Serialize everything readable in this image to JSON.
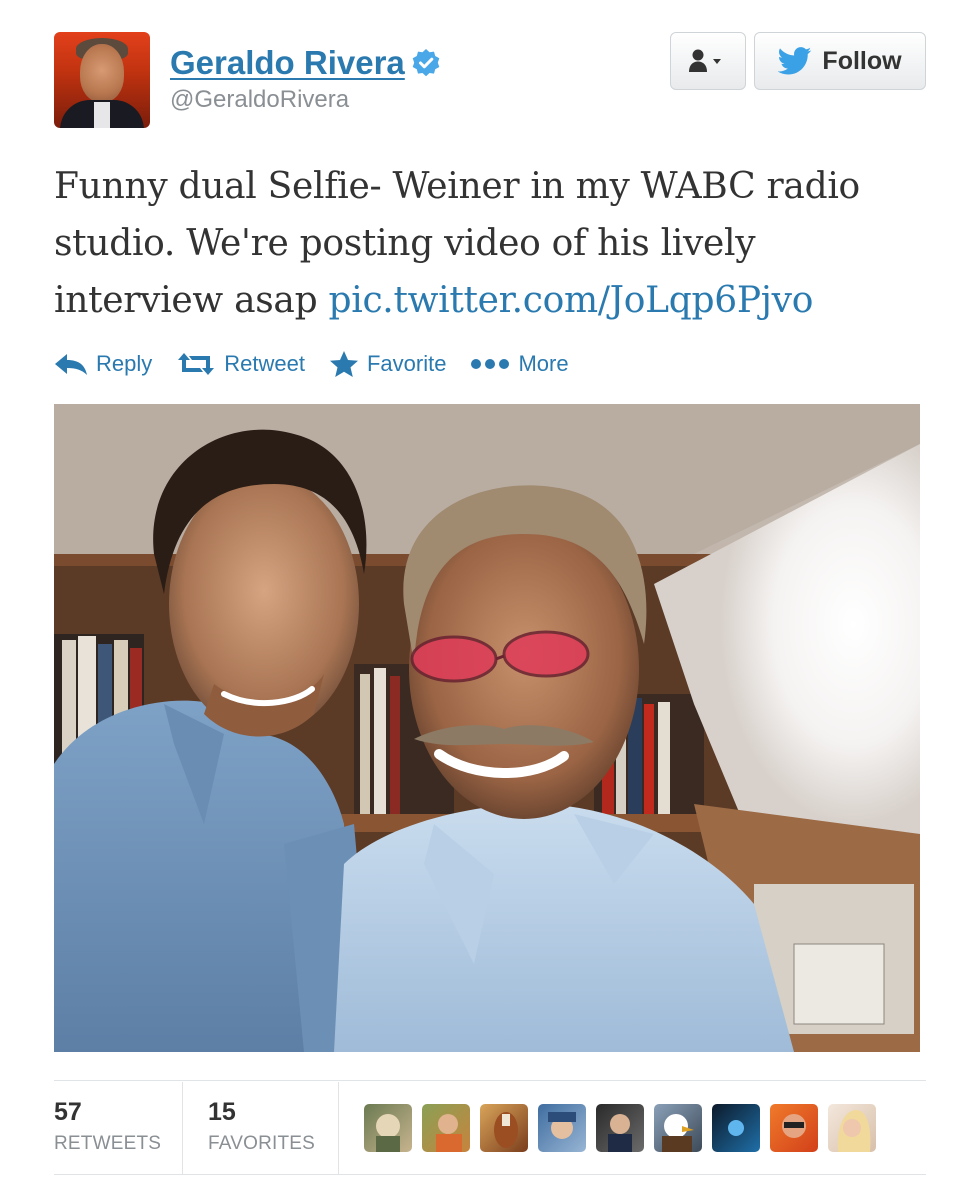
{
  "user": {
    "display_name": "Geraldo Rivera",
    "screen_name": "@GeraldoRivera",
    "avatar_icon": "user-photo",
    "verified_icon": "verified-badge-icon"
  },
  "buttons": {
    "user_dropdown_icon": "user-dropdown-icon",
    "follow_label": "Follow",
    "follow_icon": "twitter-bird-icon"
  },
  "tweet": {
    "text": "Funny dual Selfie- Weiner in my WABC radio studio. We're posting video of his lively interview asap ",
    "link": "pic.twitter.com/JoLqp6Pjvo"
  },
  "actions": [
    {
      "label": "Reply",
      "icon": "reply-icon"
    },
    {
      "label": "Retweet",
      "icon": "retweet-icon"
    },
    {
      "label": "Favorite",
      "icon": "star-icon"
    },
    {
      "label": "More",
      "icon": "more-dots-icon"
    }
  ],
  "stats": {
    "retweets_count": "57",
    "retweets_label": "RETWEETS",
    "favorites_count": "15",
    "favorites_label": "FAVORITES"
  },
  "favoriters": [
    {
      "icon": "user-avatar-1"
    },
    {
      "icon": "user-avatar-2"
    },
    {
      "icon": "user-avatar-3"
    },
    {
      "icon": "user-avatar-4"
    },
    {
      "icon": "user-avatar-5"
    },
    {
      "icon": "user-avatar-6"
    },
    {
      "icon": "user-avatar-7"
    },
    {
      "icon": "user-avatar-8"
    },
    {
      "icon": "user-avatar-9"
    }
  ],
  "colors": {
    "link": "#2a7ab0",
    "verified": "#4aa8e8",
    "follow_bird": "#3ba1e6"
  }
}
